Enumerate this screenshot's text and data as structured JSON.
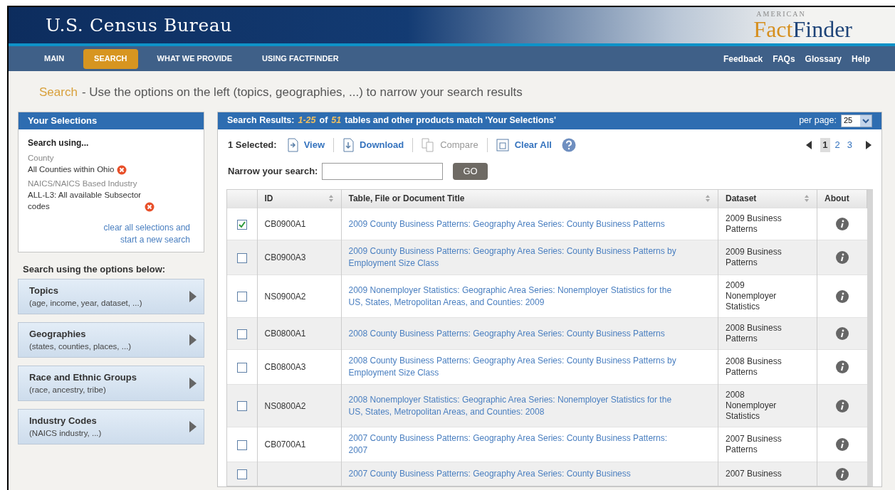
{
  "header": {
    "agency": "U.S. Census Bureau",
    "logo_top": "AMERICAN",
    "logo_first": "Fact",
    "logo_second": "Finder"
  },
  "nav": [
    {
      "label": "MAIN",
      "selected": false
    },
    {
      "label": "SEARCH",
      "selected": true
    },
    {
      "label": "WHAT WE PROVIDE",
      "selected": false
    },
    {
      "label": "USING FACTFINDER",
      "selected": false
    }
  ],
  "utility_links": [
    "Feedback",
    "FAQs",
    "Glossary",
    "Help"
  ],
  "page_heading": {
    "title": "Search",
    "text": "- Use the options on the left (topics, geographies, ...) to narrow your search results"
  },
  "selections": {
    "title": "Your Selections",
    "heading": "Search using...",
    "items": [
      {
        "category": "County",
        "value": "All Counties within Ohio"
      },
      {
        "category": "NAICS/NAICS Based Industry",
        "value": "ALL-L3: All available Subsector codes"
      }
    ],
    "clear_link": "clear all selections and start a new search"
  },
  "options": {
    "title": "Search using the options below:",
    "items": [
      {
        "title": "Topics",
        "hint": "(age, income, year, dataset, ...)"
      },
      {
        "title": "Geographies",
        "hint": "(states, counties, places, ...)"
      },
      {
        "title": "Race and Ethnic Groups",
        "hint": "(race, ancestry, tribe)"
      },
      {
        "title": "Industry Codes",
        "hint": "(NAICS industry, ...)"
      }
    ]
  },
  "results": {
    "header": [
      {
        "text": "Search Results:",
        "highlight": false
      },
      {
        "text": "1-25",
        "highlight": true
      },
      {
        "text": "of",
        "highlight": false
      },
      {
        "text": "51",
        "highlight": true
      },
      {
        "text": "tables and other products match 'Your Selections'",
        "highlight": false
      }
    ],
    "per_page_label": "per page:",
    "per_page": "25",
    "selected_count": "1 Selected:",
    "actions": [
      {
        "label": "View",
        "kind": "view",
        "disabled": false
      },
      {
        "label": "Download",
        "kind": "download",
        "disabled": false
      },
      {
        "label": "Compare",
        "kind": "compare",
        "disabled": true
      },
      {
        "label": "Clear All",
        "kind": "clear",
        "disabled": false
      }
    ],
    "pages": [
      {
        "label": "1",
        "selected": true
      },
      {
        "label": "2",
        "selected": false
      },
      {
        "label": "3",
        "selected": false
      }
    ],
    "narrow_label": "Narrow your search:",
    "go_button": "GO",
    "columns": [
      {
        "label": "ID",
        "sortable": true
      },
      {
        "label": "Table, File or Document Title",
        "sortable": true
      },
      {
        "label": "Dataset",
        "sortable": true
      },
      {
        "label": "About",
        "sortable": false
      }
    ],
    "rows": [
      {
        "id": "CB0900A1",
        "title": "2009 County Business Patterns: Geography Area Series: County Business Patterns",
        "dataset": "2009 Business Patterns",
        "checked": true
      },
      {
        "id": "CB0900A3",
        "title": "2009 County Business Patterns: Geography Area Series: County Business Patterns by Employment Size Class",
        "dataset": "2009 Business Patterns",
        "checked": false
      },
      {
        "id": "NS0900A2",
        "title": "2009 Nonemployer Statistics: Geographic Area Series: Nonemployer Statistics for the US, States, Metropolitan Areas, and Counties: 2009",
        "dataset": "2009 Nonemployer Statistics",
        "checked": false
      },
      {
        "id": "CB0800A1",
        "title": "2008 County Business Patterns: Geography Area Series: County Business Patterns",
        "dataset": "2008 Business Patterns",
        "checked": false
      },
      {
        "id": "CB0800A3",
        "title": "2008 County Business Patterns: Geography Area Series: County Business Patterns by Employment Size Class",
        "dataset": "2008 Business Patterns",
        "checked": false
      },
      {
        "id": "NS0800A2",
        "title": "2008 Nonemployer Statistics: Geographic Area Series: Nonemployer Statistics for the US, States, Metropolitan Areas, and Counties: 2008",
        "dataset": "2008 Nonemployer Statistics",
        "checked": false
      },
      {
        "id": "CB0700A1",
        "title": "2007 County Business Patterns: Geography Area Series: County Business Patterns: 2007",
        "dataset": "2007 Business Patterns",
        "checked": false
      },
      {
        "title": "2007 County Business Patterns: Geography Area Series: County Business",
        "dataset": "2007 Business",
        "checked": false
      }
    ]
  }
}
